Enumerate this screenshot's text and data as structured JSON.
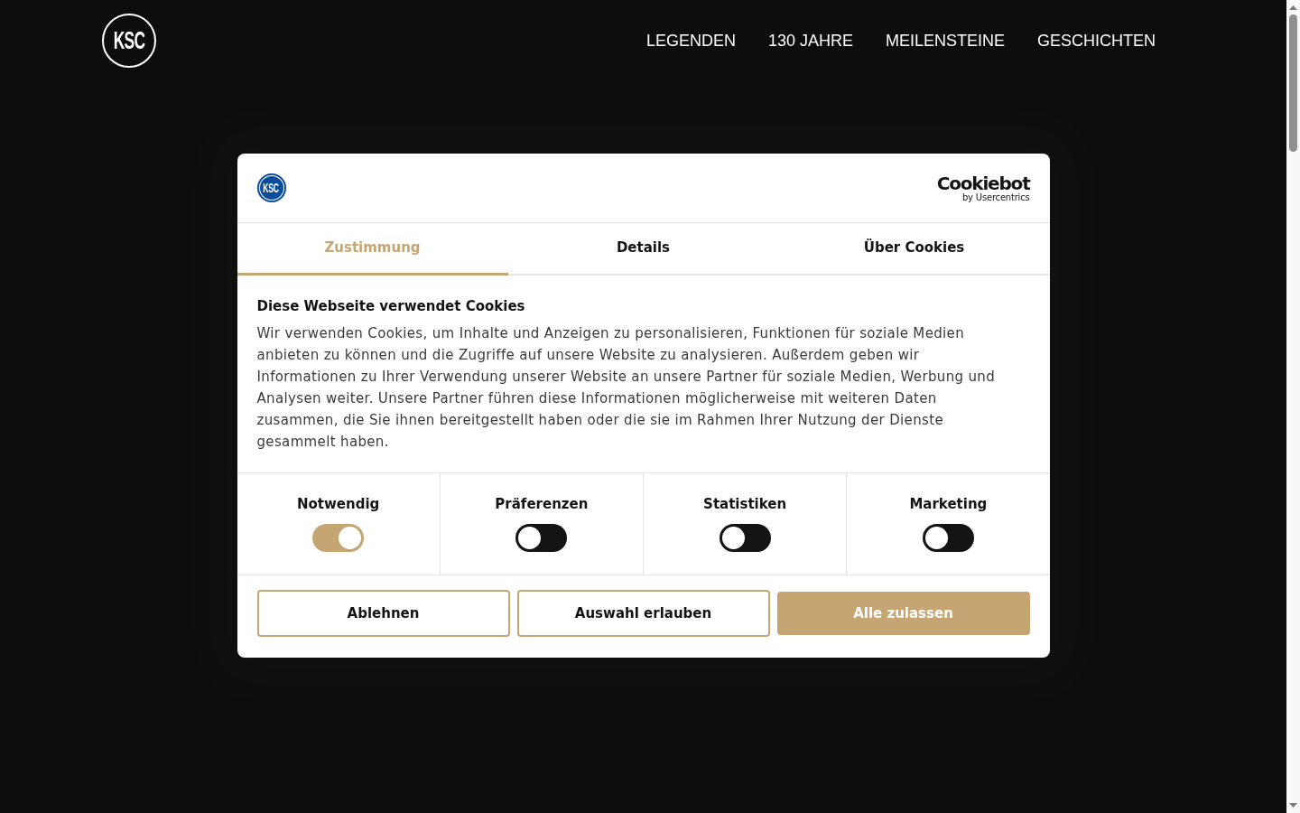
{
  "header": {
    "logo_text": "KSC",
    "nav": [
      "LEGENDEN",
      "130 JAHRE",
      "MEILENSTEINE",
      "GESCHICHTEN"
    ]
  },
  "cookie_dialog": {
    "logo_text": "KSC",
    "brand": {
      "name": "Cookiebot",
      "byline": "by Usercentrics"
    },
    "tabs": [
      {
        "label": "Zustimmung",
        "selected": true
      },
      {
        "label": "Details",
        "selected": false
      },
      {
        "label": "Über Cookies",
        "selected": false
      }
    ],
    "title": "Diese Webseite verwendet Cookies",
    "description": "Wir verwenden Cookies, um Inhalte und Anzeigen zu personalisieren, Funktionen für soziale Medien anbieten zu können und die Zugriffe auf unsere Website zu analysieren. Außerdem geben wir Informationen zu Ihrer Verwendung unserer Website an unsere Partner für soziale Medien, Werbung und Analysen weiter. Unsere Partner führen diese Informationen möglicherweise mit weiteren Daten zusammen, die Sie ihnen bereitgestellt haben oder die sie im Rahmen Ihrer Nutzung der Dienste gesammelt haben.",
    "categories": [
      {
        "label": "Notwendig",
        "on": true
      },
      {
        "label": "Präferenzen",
        "on": false
      },
      {
        "label": "Statistiken",
        "on": false
      },
      {
        "label": "Marketing",
        "on": false
      }
    ],
    "buttons": [
      {
        "label": "Ablehnen",
        "kind": "outline"
      },
      {
        "label": "Auswahl erlauben",
        "kind": "outline"
      },
      {
        "label": "Alle zulassen",
        "kind": "filled"
      }
    ]
  }
}
